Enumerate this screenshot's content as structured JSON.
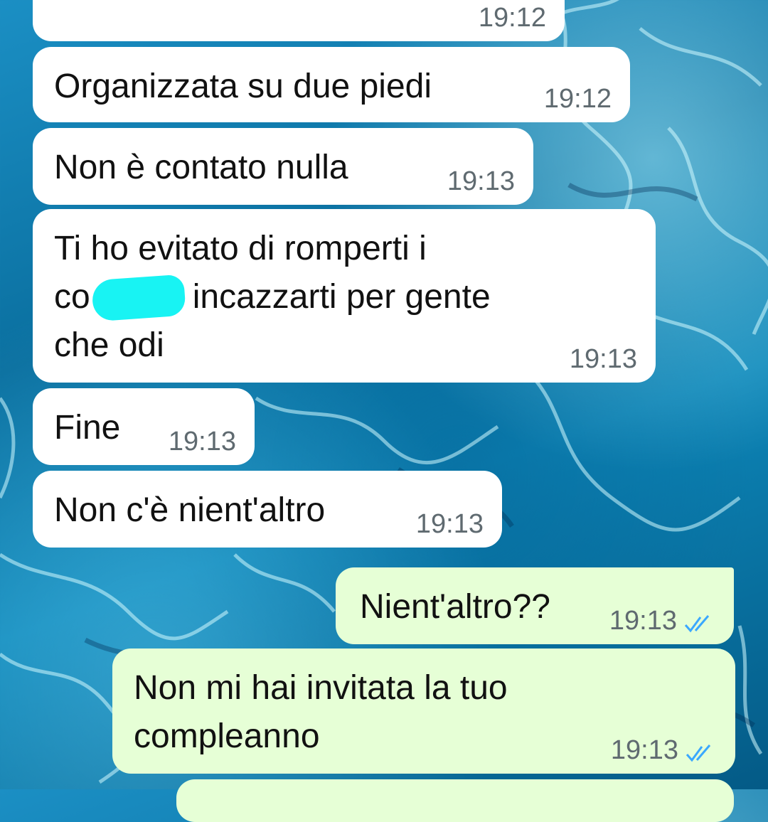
{
  "colors": {
    "incoming_bubble": "#ffffff",
    "outgoing_bubble": "#e6ffd6",
    "read_ticks": "#3aa8ff",
    "redaction": "#18f3f3"
  },
  "messages": [
    {
      "direction": "in",
      "text": "",
      "time": "19:12"
    },
    {
      "direction": "in",
      "text": "Organizzata su due piedi",
      "time": "19:12"
    },
    {
      "direction": "in",
      "text": "Non è contato nulla",
      "time": "19:13"
    },
    {
      "direction": "in",
      "text": "Ti ho evitato di romperti i\nco      j e incazzarti per gente\nche odi",
      "time": "19:13"
    },
    {
      "direction": "in",
      "text": "Fine",
      "time": "19:13"
    },
    {
      "direction": "in",
      "text": "Non c'è nient'altro",
      "time": "19:13"
    },
    {
      "direction": "out",
      "text": "Nient'altro??",
      "time": "19:13",
      "status": "read"
    },
    {
      "direction": "out",
      "text": "Non mi hai invitata la tuo\ncompleanno",
      "time": "19:13",
      "status": "read"
    }
  ]
}
